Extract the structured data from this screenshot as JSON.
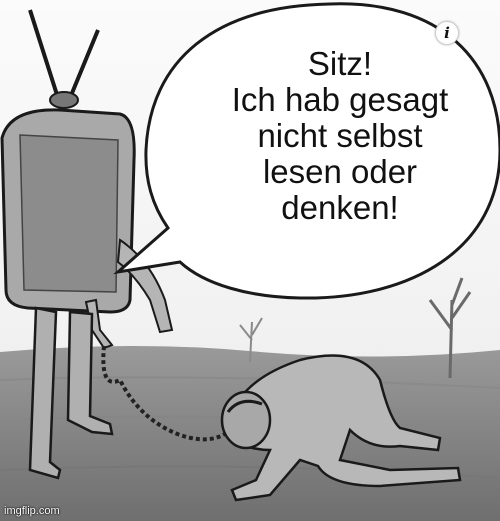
{
  "meme": {
    "speech_lines": [
      "Sitz!",
      "Ich hab gesagt",
      "nicht selbst",
      "lesen oder",
      "denken!"
    ],
    "watermark": "imgflip.com"
  },
  "info_badge": {
    "icon": "info-icon",
    "label": "i"
  },
  "colors": {
    "ground": "#7d7d7d",
    "figure": "#a9a9a9",
    "outline": "#1a1a1a",
    "bubble": "#ffffff"
  }
}
